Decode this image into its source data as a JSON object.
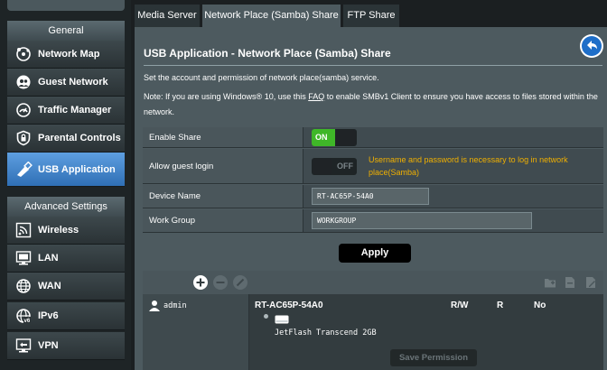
{
  "sidebar": {
    "general_label": "General",
    "advanced_label": "Advanced Settings",
    "items": [
      {
        "label": "Network Map",
        "icon": "network-map-icon"
      },
      {
        "label": "Guest Network",
        "icon": "guest-network-icon"
      },
      {
        "label": "Traffic Manager",
        "icon": "traffic-manager-icon"
      },
      {
        "label": "Parental Controls",
        "icon": "parental-controls-icon"
      },
      {
        "label": "USB Application",
        "icon": "usb-application-icon",
        "active": true
      }
    ],
    "advanced_items": [
      {
        "label": "Wireless",
        "icon": "wireless-icon"
      },
      {
        "label": "LAN",
        "icon": "lan-icon"
      },
      {
        "label": "WAN",
        "icon": "wan-icon"
      },
      {
        "label": "IPv6",
        "icon": "ipv6-icon"
      },
      {
        "label": "VPN",
        "icon": "vpn-icon"
      }
    ]
  },
  "tabs": [
    {
      "label": "Media Server"
    },
    {
      "label": "Network Place (Samba) Share",
      "active": true
    },
    {
      "label": "FTP Share"
    }
  ],
  "page": {
    "title": "USB Application - Network Place (Samba) Share",
    "description": "Set the account and permission of network place(samba) service.",
    "note_before": "Note: If you are using Windows® 10, use this ",
    "note_link": "FAQ",
    "note_after": " to enable SMBv1 Client to ensure you have access to files stored within the network."
  },
  "form": {
    "enable_share": {
      "label": "Enable Share",
      "state": "ON"
    },
    "guest_login": {
      "label": "Allow guest login",
      "state": "OFF",
      "warning": "Username and password is necessary to log in network place(Samba)"
    },
    "device_name": {
      "label": "Device Name",
      "value": "RT-AC65P-54A0"
    },
    "work_group": {
      "label": "Work Group",
      "value": "WORKGROUP"
    }
  },
  "apply_label": "Apply",
  "permissions": {
    "user": "admin",
    "device": "RT-AC65P-54A0",
    "columns": [
      "R/W",
      "R",
      "No"
    ],
    "drive": "JetFlash Transcend 2GB",
    "save_label": "Save Permission"
  },
  "colors": {
    "accent_active": "#3f82cc",
    "toggle_on": "#3fb728",
    "warning": "#f0b000",
    "panel": "#4d5a5f"
  }
}
